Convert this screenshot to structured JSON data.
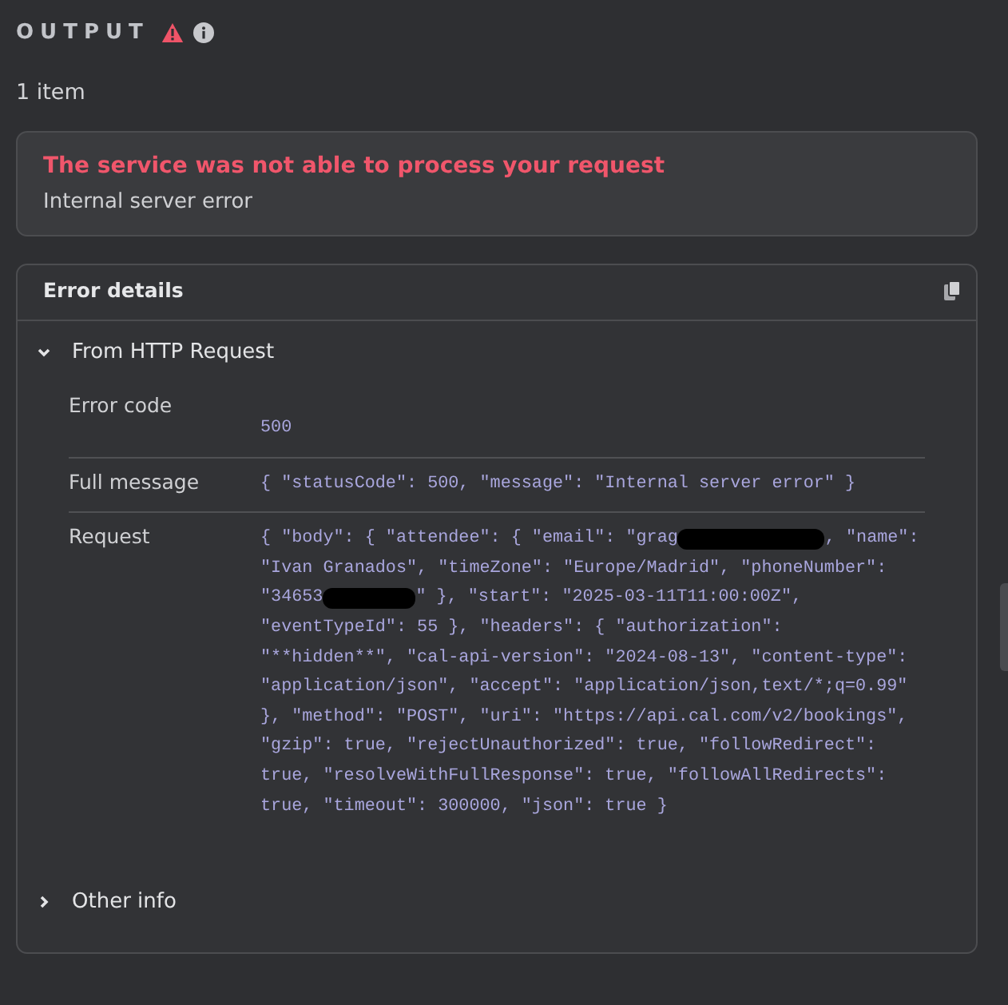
{
  "header": {
    "title": "OUTPUT"
  },
  "item_count": "1 item",
  "error_banner": {
    "title": "The service was not able to process your request",
    "message": "Internal server error"
  },
  "details": {
    "title": "Error details",
    "sections": [
      {
        "label": "From HTTP Request",
        "expanded": true,
        "rows": [
          {
            "label": "Error code",
            "lines": [
              [
                {
                  "kind": "text",
                  "text": "500"
                }
              ]
            ]
          },
          {
            "label": "Full message",
            "lines": [
              [
                {
                  "kind": "text",
                  "text": "{ \"statusCode\": 500, \"message\": \"Internal server error\" }"
                }
              ]
            ]
          },
          {
            "label": "Request",
            "lines": [
              [
                {
                  "kind": "text",
                  "text": "{ \"body\": { \"attendee\": { \"email\": \"grag"
                },
                {
                  "kind": "redacted"
                },
                {
                  "kind": "text",
                  "text": ", \"name\":"
                }
              ],
              [
                {
                  "kind": "text",
                  "text": "\"Ivan Granados\", \"timeZone\": \"Europe/Madrid\", \"phoneNumber\":"
                }
              ],
              [
                {
                  "kind": "text",
                  "text": "\"34653"
                },
                {
                  "kind": "redacted"
                },
                {
                  "kind": "text",
                  "text": "\" }, \"start\": \"2025-03-11T11:00:00Z\","
                }
              ],
              [
                {
                  "kind": "text",
                  "text": "\"eventTypeId\": 55 }, \"headers\": { \"authorization\":"
                }
              ],
              [
                {
                  "kind": "text",
                  "text": "\"**hidden**\", \"cal-api-version\": \"2024-08-13\", \"content-type\":"
                }
              ],
              [
                {
                  "kind": "text",
                  "text": "\"application/json\", \"accept\": \"application/json,text/*;q=0.99\""
                }
              ],
              [
                {
                  "kind": "text",
                  "text": "}, \"method\": \"POST\", \"uri\": \"https://api.cal.com/v2/bookings\","
                }
              ],
              [
                {
                  "kind": "text",
                  "text": "\"gzip\": true, \"rejectUnauthorized\": true, \"followRedirect\":"
                }
              ],
              [
                {
                  "kind": "text",
                  "text": "true, \"resolveWithFullResponse\": true, \"followAllRedirects\":"
                }
              ],
              [
                {
                  "kind": "text",
                  "text": "true, \"timeout\": 300000, \"json\": true }"
                }
              ]
            ]
          }
        ]
      },
      {
        "label": "Other info",
        "expanded": false
      }
    ]
  }
}
